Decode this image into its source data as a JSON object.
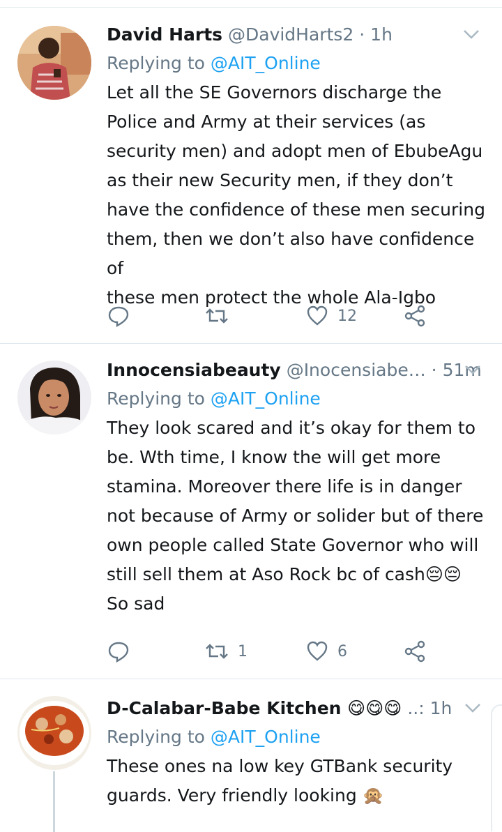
{
  "tweets": [
    {
      "name": "David Harts",
      "handle": "@DavidHarts2",
      "sep": "·",
      "time": "1h",
      "replying_prefix": "Replying to",
      "replying_to": "@AIT_Online",
      "lines": [
        "Let all the SE Governors discharge the",
        "Police and Army at their services (as",
        "security men) and adopt men of EbubeAgu",
        "as their new Security men, if they don’t",
        "have the confidence of these men securing",
        "them, then we don’t also have confidence of",
        "these men protect the whole Ala-Igbo"
      ],
      "retweets": "",
      "likes": "12"
    },
    {
      "name": "Innocensiabeauty",
      "handle": "@Inocensiabe…",
      "sep": "·",
      "time": "51m",
      "replying_prefix": "Replying to",
      "replying_to": "@AIT_Online",
      "lines": [
        "They look scared and it’s okay for them to",
        "be. Wth time, I know the will get more",
        "stamina. Moreover there life is in danger",
        "not because of Army or solider but of there",
        "own people called State Governor who will",
        "still sell them at Aso Rock bc of cash😔😔",
        "So sad"
      ],
      "retweets": "1",
      "likes": "6"
    },
    {
      "name": "D-Calabar-Babe Kitchen 😋😋😋",
      "handle": "..:",
      "sep": "",
      "time": "1h",
      "replying_prefix": "Replying to",
      "replying_to": "@AIT_Online",
      "lines": [
        "These ones na low key GTBank security",
        "guards. Very friendly looking 🙊"
      ],
      "retweets": "",
      "likes": ""
    }
  ],
  "colors": {
    "link": "#1da1f2",
    "muted": "#657786",
    "text": "#14171a",
    "divider": "#e1e8ed"
  },
  "icons": [
    "reply-icon",
    "retweet-icon",
    "like-icon",
    "share-icon",
    "chevron-down-icon"
  ]
}
